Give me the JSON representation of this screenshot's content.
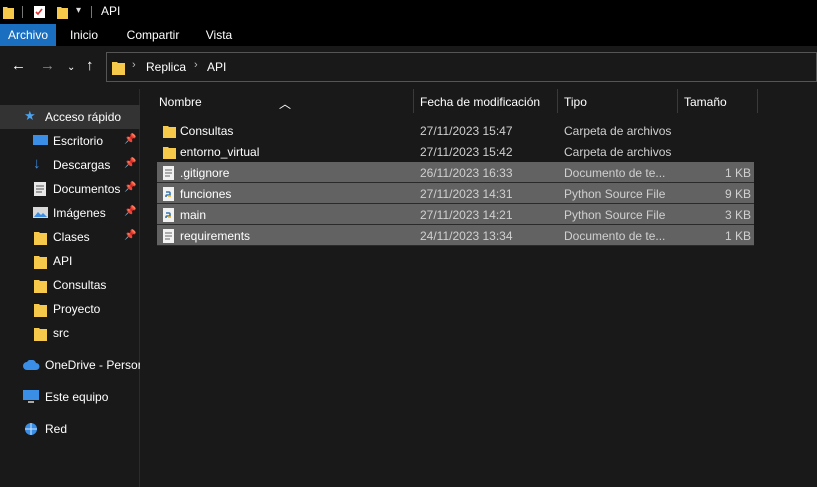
{
  "window": {
    "title": "API"
  },
  "ribbon": {
    "tabs": [
      "Archivo",
      "Inicio",
      "Compartir",
      "Vista"
    ]
  },
  "address": {
    "crumbs": [
      "Replica",
      "API"
    ]
  },
  "sidebar": {
    "quick_access": "Acceso rápido",
    "pinned": [
      "Escritorio",
      "Descargas",
      "Documentos",
      "Imágenes",
      "Clases"
    ],
    "folders": [
      "API",
      "Consultas",
      "Proyecto",
      "src"
    ],
    "onedrive": "OneDrive - Persor",
    "this_pc": "Este equipo",
    "network": "Red"
  },
  "columns": [
    "Nombre",
    "Fecha de modificación",
    "Tipo",
    "Tamaño"
  ],
  "files": [
    {
      "name": "Consultas",
      "date": "27/11/2023 15:47",
      "type": "Carpeta de archivos",
      "size": "",
      "icon": "folder-icon"
    },
    {
      "name": "entorno_virtual",
      "date": "27/11/2023 15:42",
      "type": "Carpeta de archivos",
      "size": "",
      "icon": "folder-icon"
    },
    {
      "name": ".gitignore",
      "date": "26/11/2023 16:33",
      "type": "Documento de te...",
      "size": "1 KB",
      "icon": "text-file-icon"
    },
    {
      "name": "funciones",
      "date": "27/11/2023 14:31",
      "type": "Python Source File",
      "size": "9 KB",
      "icon": "python-file-icon"
    },
    {
      "name": "main",
      "date": "27/11/2023 14:21",
      "type": "Python Source File",
      "size": "3 KB",
      "icon": "python-file-icon"
    },
    {
      "name": "requirements",
      "date": "24/11/2023 13:34",
      "type": "Documento de te...",
      "size": "1 KB",
      "icon": "text-file-icon"
    }
  ],
  "colors": {
    "accent": "#1a6fc0",
    "folder": "#f6c94a",
    "selection": "#626262"
  }
}
